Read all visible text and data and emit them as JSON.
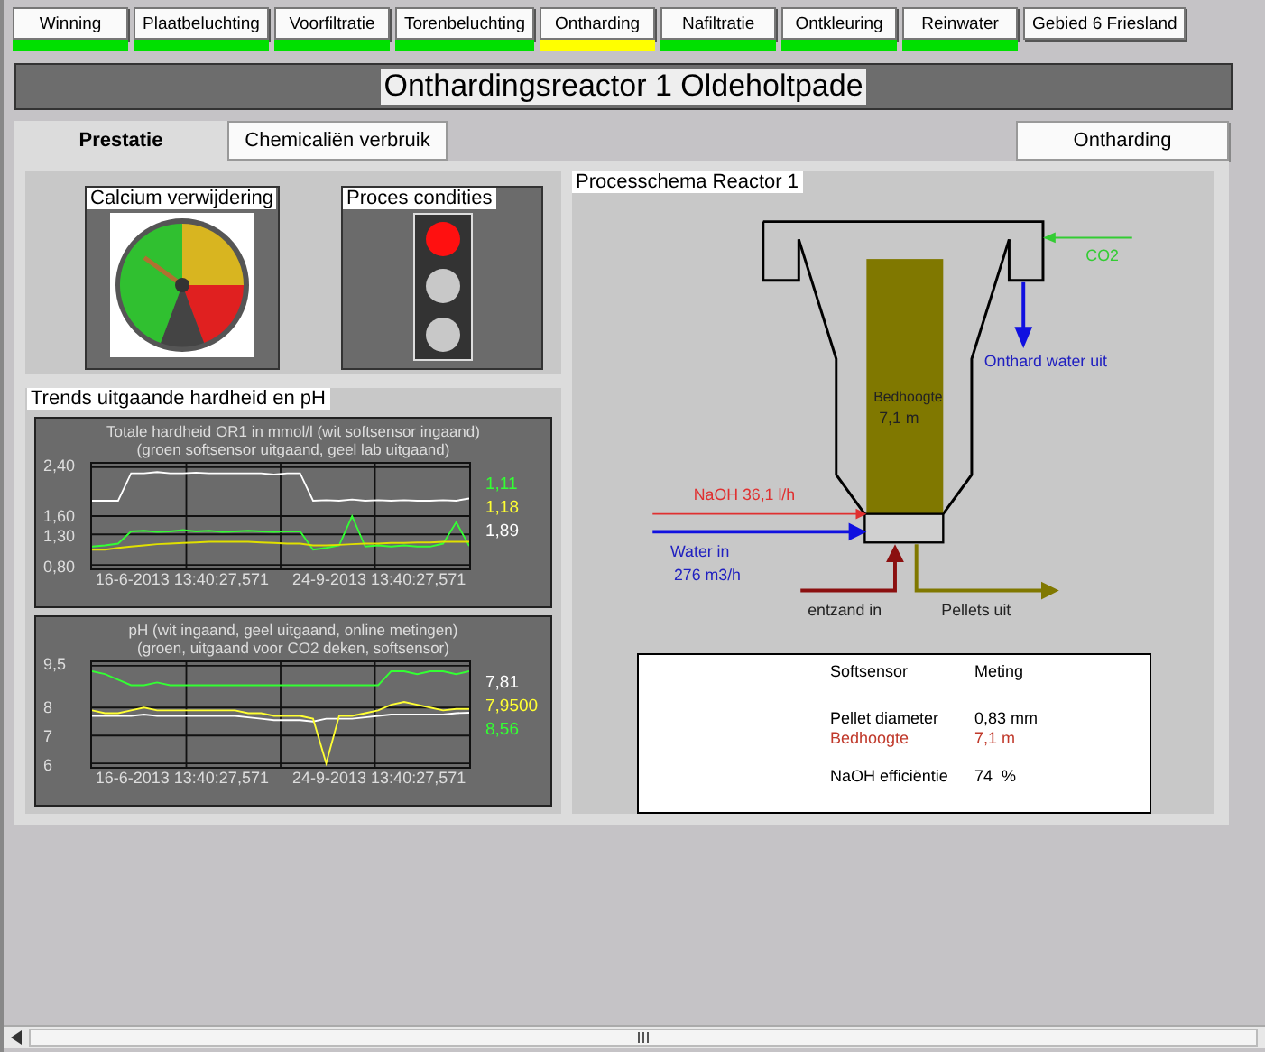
{
  "nav": [
    {
      "label": "Winning",
      "color": "#00e000"
    },
    {
      "label": "Plaatbeluchting",
      "color": "#00e000"
    },
    {
      "label": "Voorfiltratie",
      "color": "#00e000"
    },
    {
      "label": "Torenbeluchting",
      "color": "#00e000"
    },
    {
      "label": "Ontharding",
      "color": "#ffff00"
    },
    {
      "label": "Nafiltratie",
      "color": "#00e000"
    },
    {
      "label": "Ontkleuring",
      "color": "#00e000"
    },
    {
      "label": "Reinwater",
      "color": "#00e000"
    },
    {
      "label": "Gebied 6 Friesland"
    }
  ],
  "title": "Onthardingsreactor 1 Oldeholtpade",
  "tabs": [
    {
      "label": "Prestatie",
      "selected": true
    },
    {
      "label": "Chemicaliën verbruik",
      "selected": false
    }
  ],
  "section_button": "Ontharding",
  "gauge": {
    "title": "Calcium verwijdering",
    "level": 0.3
  },
  "process_conditions": {
    "title": "Proces condities",
    "lights": [
      {
        "on": true
      },
      {
        "on": false
      },
      {
        "on": false
      }
    ]
  },
  "trends": {
    "title": "Trends uitgaande hardheid en pH",
    "charts": [
      {
        "title_lines": [
          "Totale hardheid OR1 in mmol/l (wit softsensor ingaand)",
          "(groen softsensor uitgaand, geel lab uitgaand)"
        ],
        "readings": [
          {
            "value": "1,11",
            "color": "#33ff33"
          },
          {
            "value": "1,18",
            "color": "#ffff33"
          },
          {
            "value": "1,89",
            "color": "#ffffff"
          }
        ],
        "chart_data": {
          "type": "line",
          "categories": [
            null,
            null,
            null,
            null,
            null,
            null,
            null,
            "16-6-2013 13:40:27,571",
            null,
            null,
            null,
            null,
            null,
            null,
            null,
            null,
            null,
            null,
            null,
            null,
            null,
            null,
            "24-9-2013 13:40:27,571",
            null,
            null,
            null,
            null,
            null,
            null,
            null
          ],
          "ylim": [
            0.8,
            2.4
          ],
          "yticks": [
            {
              "value": 2.4,
              "label": "2,40"
            },
            {
              "value": 1.6,
              "label": "1,60"
            },
            {
              "value": 1.3,
              "label": "1,30"
            },
            {
              "value": 0.8,
              "label": "0,80"
            }
          ],
          "series": [
            {
              "color": "#ffffff",
              "values": [
                1.85,
                1.85,
                1.85,
                2.3,
                2.3,
                2.32,
                2.3,
                2.3,
                2.31,
                2.3,
                2.3,
                2.3,
                2.3,
                2.3,
                2.28,
                2.3,
                2.3,
                1.85,
                1.86,
                1.85,
                1.87,
                1.85,
                1.86,
                1.85,
                1.86,
                1.85,
                1.85,
                1.86,
                1.85,
                1.89
              ]
            },
            {
              "color": "#33ff33",
              "values": [
                1.1,
                1.12,
                1.15,
                1.35,
                1.36,
                1.34,
                1.35,
                1.37,
                1.35,
                1.36,
                1.34,
                1.35,
                1.36,
                1.35,
                1.34,
                1.35,
                1.35,
                1.05,
                1.08,
                1.12,
                1.6,
                1.1,
                1.12,
                1.1,
                1.12,
                1.1,
                1.1,
                1.15,
                1.5,
                1.11
              ]
            },
            {
              "color": "#e0e000",
              "values": [
                1.05,
                1.05,
                1.08,
                1.1,
                1.12,
                1.14,
                1.15,
                1.16,
                1.17,
                1.18,
                1.18,
                1.18,
                1.18,
                1.17,
                1.16,
                1.15,
                1.15,
                1.12,
                1.12,
                1.13,
                1.14,
                1.15,
                1.15,
                1.16,
                1.16,
                1.17,
                1.17,
                1.18,
                1.18,
                1.18
              ]
            }
          ]
        }
      },
      {
        "title_lines": [
          "pH (wit ingaand, geel uitgaand, online metingen)",
          "(groen, uitgaand voor CO2 deken, softsensor)"
        ],
        "readings": [
          {
            "value": "7,81",
            "color": "#ffffff"
          },
          {
            "value": "7,9500",
            "color": "#ffff33"
          },
          {
            "value": "8,56",
            "color": "#33ff33"
          }
        ],
        "chart_data": {
          "type": "line",
          "categories": [
            null,
            null,
            null,
            null,
            null,
            null,
            null,
            "16-6-2013 13:40:27,571",
            null,
            null,
            null,
            null,
            null,
            null,
            null,
            null,
            null,
            null,
            null,
            null,
            null,
            null,
            "24-9-2013 13:40:27,571",
            null,
            null,
            null,
            null,
            null,
            null,
            null
          ],
          "ylim": [
            6,
            9.5
          ],
          "yticks": [
            {
              "value": 9.5,
              "label": "9,5"
            },
            {
              "value": 8,
              "label": "8"
            },
            {
              "value": 7,
              "label": "7"
            },
            {
              "value": 6,
              "label": "6"
            }
          ],
          "series": [
            {
              "color": "#33ff33",
              "values": [
                9.3,
                9.2,
                9.0,
                8.8,
                8.8,
                8.9,
                8.8,
                8.8,
                8.8,
                8.8,
                8.8,
                8.8,
                8.8,
                8.8,
                8.8,
                8.8,
                8.8,
                8.8,
                8.8,
                8.8,
                8.8,
                8.8,
                8.8,
                9.3,
                9.3,
                9.2,
                9.3,
                9.3,
                9.2,
                9.3
              ]
            },
            {
              "color": "#ffffff",
              "values": [
                7.7,
                7.7,
                7.7,
                7.7,
                7.75,
                7.7,
                7.7,
                7.7,
                7.7,
                7.7,
                7.7,
                7.7,
                7.65,
                7.6,
                7.55,
                7.55,
                7.55,
                7.5,
                7.6,
                7.6,
                7.6,
                7.65,
                7.7,
                7.75,
                7.75,
                7.75,
                7.75,
                7.75,
                7.8,
                7.81
              ]
            },
            {
              "color": "#ffff33",
              "values": [
                7.9,
                7.8,
                7.8,
                7.9,
                8.0,
                7.9,
                7.9,
                7.9,
                7.9,
                7.9,
                7.9,
                7.9,
                7.8,
                7.8,
                7.7,
                7.7,
                7.7,
                7.6,
                6.0,
                7.7,
                7.7,
                7.8,
                7.9,
                8.1,
                8.2,
                8.1,
                8.0,
                7.9,
                7.95,
                7.95
              ]
            }
          ]
        }
      }
    ]
  },
  "diagram": {
    "title": "Processchema Reactor 1",
    "co2": "CO2",
    "outlet": "Onthard water uit",
    "bed_label": "Bedhoogte",
    "bed_value": "7,1 m",
    "naoh": "NaOH 36,1 l/h",
    "water_in": "Water in",
    "water_flow": "276 m3/h",
    "seed_in": "entzand in",
    "pellets_out": "Pellets uit"
  },
  "table": {
    "headers": [
      "Softsensor",
      "Meting"
    ],
    "rows": [
      {
        "label": "Pellet diameter",
        "value": "0,83 mm",
        "kind": "normal"
      },
      {
        "label": "Bedhoogte",
        "value": "7,1 m",
        "kind": "alert"
      },
      {
        "label": "NaOH efficiëntie",
        "value": "74  %",
        "kind": "normal"
      }
    ]
  }
}
